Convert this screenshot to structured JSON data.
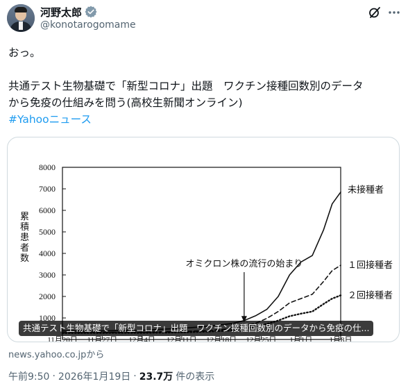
{
  "author": {
    "display_name": "河野太郎",
    "handle": "@konotarogomame",
    "verified_icon": "verified-badge-icon"
  },
  "tweet": {
    "line1": "おっ。",
    "line2": "共通テスト生物基礎で「新型コロナ」出題　ワクチン接種回数別のデータ",
    "line3": "から免疫の仕組みを問う(高校生新聞オンライン)",
    "hashtag": "#Yahooニュース"
  },
  "card": {
    "overlay_title": "共通テスト生物基礎で「新型コロナ」出題　ワクチン接種回数別のデータから免疫の仕...",
    "source": "news.yahoo.co.jpから"
  },
  "meta": {
    "time": "午前9:50",
    "separator1": "·",
    "date": "2026年1月19日",
    "separator2": "·",
    "views": "23.7万",
    "views_suffix": "件の表示"
  },
  "icons": {
    "grok": "grok-icon",
    "more": "more-icon"
  },
  "chart_data": {
    "type": "line",
    "ylabel": "累積患者数",
    "ylim": [
      0,
      8000
    ],
    "yticks": [
      1000,
      2000,
      3000,
      4000,
      5000,
      6000,
      7000,
      8000
    ],
    "x_tick_labels": [
      "11月20日",
      "11月27日",
      "12月4日",
      "12月11日",
      "12月18日",
      "12月25日",
      "1月1日",
      "1月8日"
    ],
    "xlim": [
      0,
      49
    ],
    "annotation": {
      "text": "オミクロン株の流行の始まり",
      "x": 32,
      "y": 700
    },
    "grid": false,
    "series": [
      {
        "name": "未接種者",
        "style": "solid",
        "x": [
          0,
          7,
          14,
          21,
          26,
          30,
          32,
          34,
          36,
          38,
          40,
          42,
          44,
          46,
          47.5,
          49
        ],
        "values": [
          400,
          400,
          430,
          520,
          620,
          750,
          880,
          1100,
          1400,
          2000,
          3000,
          3600,
          3900,
          5100,
          6300,
          6850
        ]
      },
      {
        "name": "１回接種者",
        "style": "dashed",
        "x": [
          0,
          7,
          14,
          21,
          26,
          30,
          32,
          34,
          36,
          38,
          40,
          42,
          44,
          46,
          47.5,
          49
        ],
        "values": [
          320,
          330,
          340,
          370,
          420,
          500,
          620,
          750,
          980,
          1300,
          1700,
          1900,
          2100,
          2700,
          3200,
          3450
        ]
      },
      {
        "name": "２回接種者",
        "style": "dotted",
        "x": [
          0,
          7,
          14,
          21,
          26,
          30,
          32,
          34,
          36,
          38,
          40,
          42,
          44,
          46,
          47.5,
          49
        ],
        "values": [
          300,
          305,
          310,
          330,
          370,
          420,
          500,
          600,
          720,
          880,
          1080,
          1200,
          1300,
          1650,
          1900,
          2050
        ]
      }
    ]
  }
}
